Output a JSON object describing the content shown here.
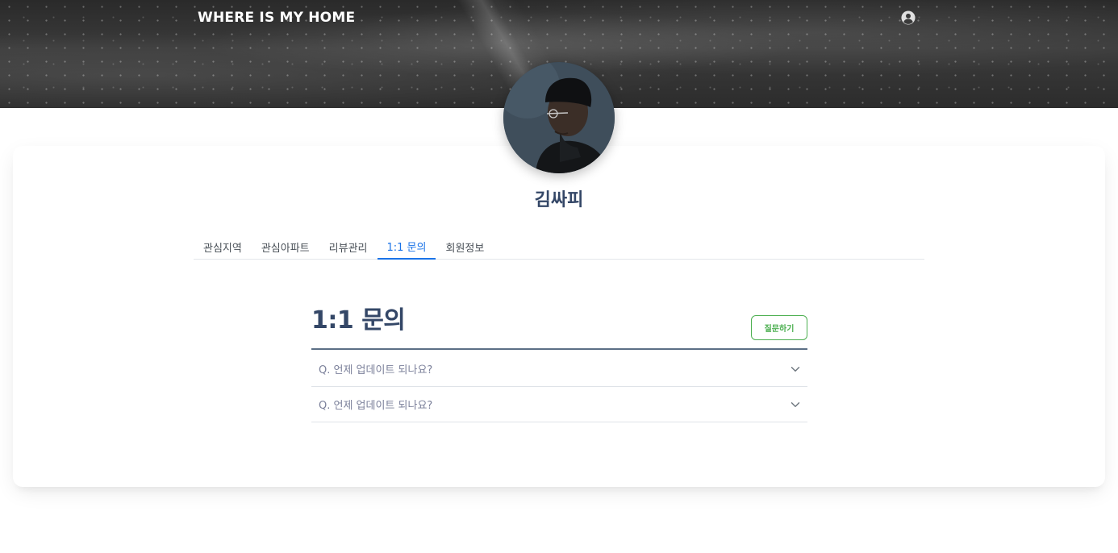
{
  "header": {
    "brand": "WHERE IS MY HOME",
    "user_icon": "user-circle-icon"
  },
  "profile": {
    "name": "김싸피"
  },
  "tabs": [
    {
      "label": "관심지역",
      "active": false
    },
    {
      "label": "관심아파트",
      "active": false
    },
    {
      "label": "리뷰관리",
      "active": false
    },
    {
      "label": "1:1 문의",
      "active": true
    },
    {
      "label": "회원정보",
      "active": false
    }
  ],
  "qna": {
    "title": "1:1 문의",
    "ask_label": "질문하기",
    "items": [
      {
        "question": "Q. 언제 업데이트 되나요?",
        "icon": "chevron-down-icon"
      },
      {
        "question": "Q. 언제 업데이트 되나요?",
        "icon": "chevron-down-icon"
      }
    ]
  },
  "colors": {
    "accent": "#1A73E8",
    "success": "#4CAF50",
    "text": "#344767"
  }
}
